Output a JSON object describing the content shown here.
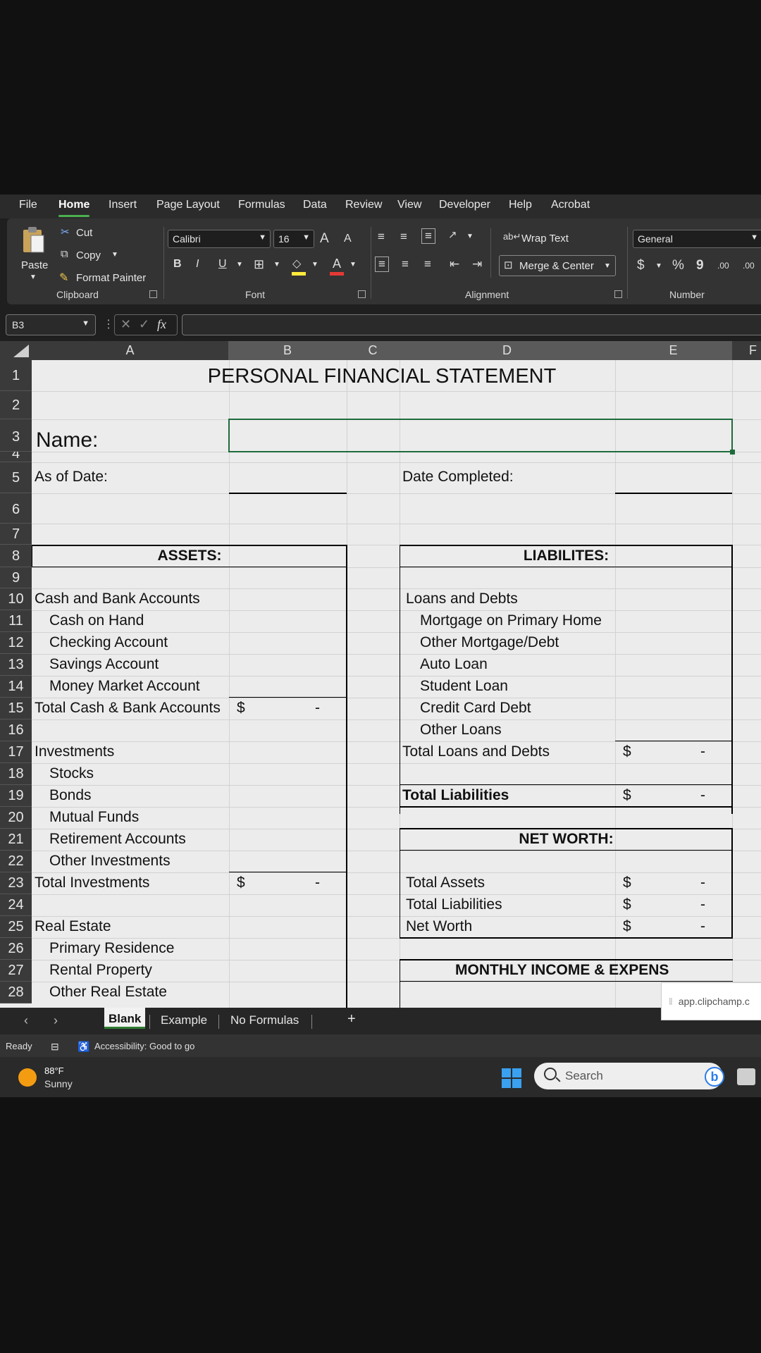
{
  "menu": {
    "tabs": [
      "File",
      "Home",
      "Insert",
      "Page Layout",
      "Formulas",
      "Data",
      "Review",
      "View",
      "Developer",
      "Help",
      "Acrobat"
    ],
    "active": "Home"
  },
  "ribbon": {
    "clipboard": {
      "paste": "Paste",
      "cut": "Cut",
      "copy": "Copy",
      "format_painter": "Format Painter",
      "label": "Clipboard"
    },
    "font": {
      "family": "Calibri",
      "size": "16",
      "bold": "B",
      "italic": "I",
      "underline": "U",
      "grow": "A",
      "shrink": "A",
      "font_color": "A",
      "label": "Font"
    },
    "alignment": {
      "wrap_text": "Wrap Text",
      "merge_center": "Merge & Center",
      "label": "Alignment"
    },
    "number": {
      "format": "General",
      "currency": "$",
      "percent": "%",
      "comma": "9",
      "inc_decimal": ".00",
      "dec_decimal": ".00",
      "label": "Number"
    }
  },
  "formula_bar": {
    "name_box": "B3",
    "fx": "fx",
    "value": ""
  },
  "columns": [
    "A",
    "B",
    "C",
    "D",
    "E",
    "F"
  ],
  "rows": [
    "1",
    "2",
    "3",
    "4",
    "5",
    "6",
    "7",
    "8",
    "9",
    "10",
    "11",
    "12",
    "13",
    "14",
    "15",
    "16",
    "17",
    "18",
    "19",
    "20",
    "21",
    "22",
    "23",
    "24",
    "25",
    "26",
    "27",
    "28"
  ],
  "sheet": {
    "title": "PERSONAL FINANCIAL STATEMENT",
    "name_label": "Name:",
    "as_of_date": "As of Date:",
    "date_completed": "Date Completed:",
    "assets_header": "ASSETS:",
    "liabilities_header": "LIABILITES:",
    "assets": {
      "cash_bank": "Cash and Bank Accounts",
      "cash_on_hand": "Cash on Hand",
      "checking": "Checking Account",
      "savings": "Savings Account",
      "money_market": "Money Market Account",
      "total_cash_bank": "Total Cash & Bank Accounts",
      "investments": "Investments",
      "stocks": "Stocks",
      "bonds": "Bonds",
      "mutual_funds": "Mutual Funds",
      "retirement": "Retirement Accounts",
      "other_investments": "Other Investments",
      "total_investments": "Total Investments",
      "real_estate": "Real Estate",
      "primary_residence": "Primary Residence",
      "rental_property": "Rental Property",
      "other_real_estate": "Other Real Estate"
    },
    "liabilities": {
      "loans_debts": "Loans and Debts",
      "mortgage_primary": "Mortgage on Primary Home",
      "other_mortgage": "Other Mortgage/Debt",
      "auto_loan": "Auto Loan",
      "student_loan": "Student Loan",
      "credit_card": "Credit Card Debt",
      "other_loans": "Other Loans",
      "total_loans_debts": "Total Loans and Debts",
      "total_liabilities": "Total Liabilities"
    },
    "net_worth_header": "NET WORTH:",
    "net_worth": {
      "total_assets": "Total Assets",
      "total_liabilities": "Total Liabilities",
      "net_worth": "Net Worth"
    },
    "monthly_header": "MONTHLY INCOME & EXPENS",
    "currency_symbol": "$",
    "empty_value": "-"
  },
  "sheet_tabs": {
    "items": [
      "Blank",
      "Example",
      "No Formulas"
    ],
    "active": "Blank",
    "add": "+"
  },
  "popup": {
    "text": "app.clipchamp.c"
  },
  "status": {
    "ready": "Ready",
    "accessibility": "Accessibility: Good to go"
  },
  "taskbar": {
    "temperature": "88°F",
    "condition": "Sunny",
    "search_placeholder": "Search"
  }
}
